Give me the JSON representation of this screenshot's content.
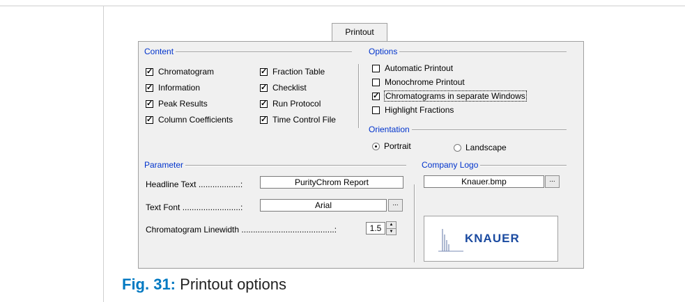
{
  "tab": {
    "label": "Printout"
  },
  "content": {
    "title": "Content",
    "col1": [
      {
        "label": "Chromatogram",
        "checked": true
      },
      {
        "label": "Information",
        "checked": true
      },
      {
        "label": "Peak Results",
        "checked": true
      },
      {
        "label": "Column Coefficients",
        "checked": true
      }
    ],
    "col2": [
      {
        "label": "Fraction Table",
        "checked": true
      },
      {
        "label": "Checklist",
        "checked": true
      },
      {
        "label": "Run Protocol",
        "checked": true
      },
      {
        "label": "Time Control File",
        "checked": true
      }
    ]
  },
  "options": {
    "title": "Options",
    "items": [
      {
        "label": "Automatic Printout",
        "checked": false
      },
      {
        "label": "Monochrome Printout",
        "checked": false
      },
      {
        "label": "Chromatograms in separate Windows",
        "checked": true
      },
      {
        "label": "Highlight Fractions",
        "checked": false
      }
    ]
  },
  "orientation": {
    "title": "Orientation",
    "portrait": "Portrait",
    "landscape": "Landscape",
    "selected": "Portrait"
  },
  "parameter": {
    "title": "Parameter",
    "headline_label": "Headline Text ..................:",
    "headline_value": "PurityChrom Report",
    "font_label": "Text Font .........................:",
    "font_value": "Arial",
    "linewidth_label": "Chromatogram Linewidth ........................................:",
    "linewidth_value": "1.5"
  },
  "company_logo": {
    "title": "Company Logo",
    "file_value": "Knauer.bmp",
    "logo_text": "KNAUER"
  },
  "browse_label": "...",
  "caption": {
    "figure": "Fig. 31:",
    "text": "Printout options"
  },
  "colors": {
    "group_title": "#0033cc",
    "caption_fig": "#0079c2",
    "logo": "#1a4aa0"
  }
}
